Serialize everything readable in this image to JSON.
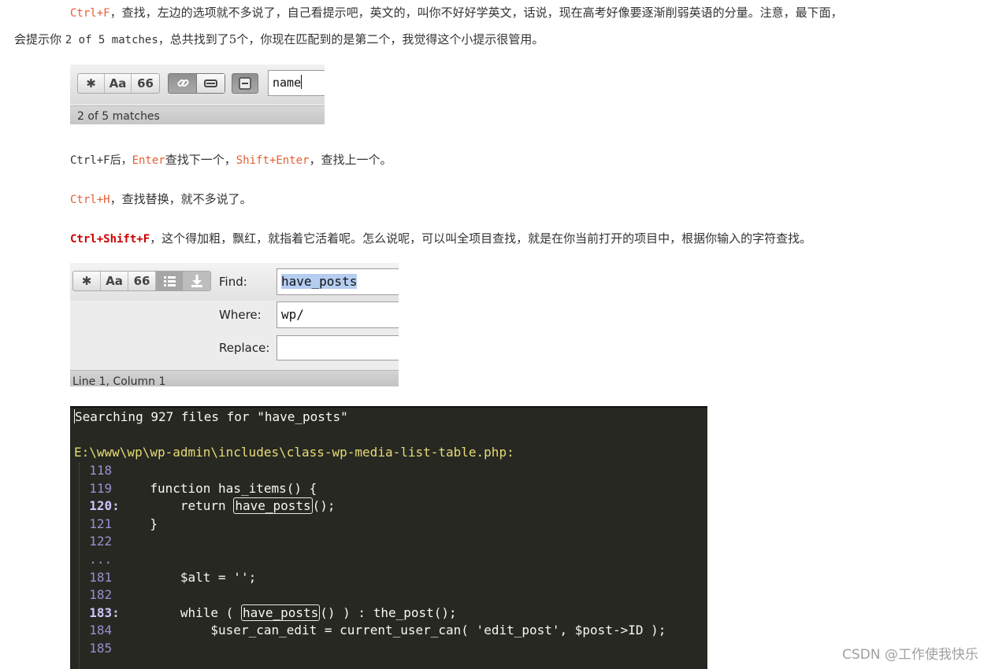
{
  "para1": {
    "line1_key": "Ctrl+F",
    "line1_text": "，查找，左边的选项就不多说了，自己看提示吧，英文的，叫你不好好学英文，话说，现在高考好像要逐渐削弱英语的分量。注意，最下面，",
    "line2_pre": "会提示你 ",
    "line2_code": "2 of 5 matches",
    "line2_post": "，总共找到了5个，你现在匹配到的是第二个，我觉得这个小提示很管用。"
  },
  "findbar1": {
    "btn_regex": "✱",
    "btn_case": "Aa",
    "btn_word": "66",
    "search_value": "name",
    "status": "2 of 5 matches"
  },
  "para2": {
    "pre": "Ctrl+F后，",
    "k1": "Enter",
    "mid": "查找下一个，",
    "k2": "Shift+Enter",
    "post": "，查找上一个。"
  },
  "para3": {
    "key": "Ctrl+H",
    "text": "，查找替换，就不多说了。"
  },
  "para4": {
    "key": "Ctrl+Shift+F",
    "text": "，这个得加粗，飘红，就指着它活着呢。怎么说呢，可以叫全项目查找，就是在你当前打开的项目中，根据你输入的字符查找。"
  },
  "findbar2": {
    "btn_regex": "✱",
    "btn_case": "Aa",
    "btn_word": "66",
    "find_label": "Find:",
    "find_value": "have_posts",
    "where_label": "Where:",
    "where_value": "wp/",
    "replace_label": "Replace:",
    "replace_value": "",
    "status": "Line 1, Column 1"
  },
  "terminal": {
    "header": "Searching 927 files for \"have_posts\"",
    "file_path": "E:\\www\\wp\\wp-admin\\includes\\class-wp-media-list-table.php:",
    "lines": [
      {
        "num": "118",
        "sep": "",
        "pre": "",
        "match": "",
        "post": ""
      },
      {
        "num": "119",
        "sep": "",
        "pre": "  function has_items() {",
        "match": "",
        "post": ""
      },
      {
        "num": "120",
        "sep": ":",
        "pre": "      return ",
        "match": "have_posts",
        "post": "();"
      },
      {
        "num": "121",
        "sep": "",
        "pre": "  }",
        "match": "",
        "post": ""
      },
      {
        "num": "122",
        "sep": "",
        "pre": "",
        "match": "",
        "post": ""
      },
      {
        "num": "...",
        "sep": "",
        "pre": "",
        "match": "",
        "post": ""
      },
      {
        "num": "181",
        "sep": "",
        "pre": "      $alt = '';",
        "match": "",
        "post": ""
      },
      {
        "num": "182",
        "sep": "",
        "pre": "",
        "match": "",
        "post": ""
      },
      {
        "num": "183",
        "sep": ":",
        "pre": "      while ( ",
        "match": "have_posts",
        "post": "() ) : the_post();"
      },
      {
        "num": "184",
        "sep": "",
        "pre": "          $user_can_edit = current_user_can( 'edit_post', $post->ID );",
        "match": "",
        "post": ""
      },
      {
        "num": "185",
        "sep": "",
        "pre": "",
        "match": "",
        "post": ""
      }
    ]
  },
  "watermark": "CSDN @工作使我快乐"
}
